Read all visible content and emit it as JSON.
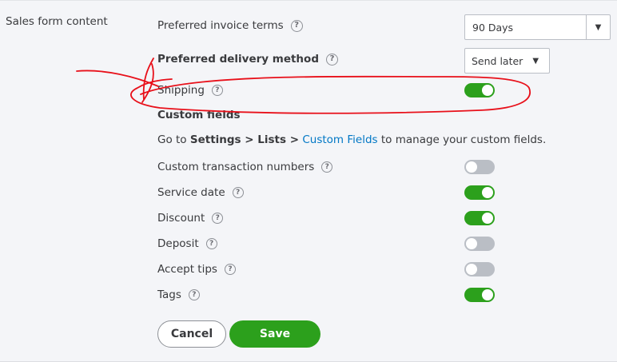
{
  "section": {
    "label": "Sales form content"
  },
  "invoice_terms": {
    "label": "Preferred invoice terms",
    "value": "90 Days"
  },
  "delivery_method": {
    "label": "Preferred delivery method",
    "value": "Send later"
  },
  "shipping": {
    "label": "Shipping",
    "enabled": true
  },
  "custom_fields": {
    "heading": "Custom fields",
    "info_prefix": "Go to ",
    "info_path": "Settings > Lists >",
    "info_link": "Custom Fields",
    "info_suffix": " to manage your custom fields."
  },
  "toggles": [
    {
      "label": "Custom transaction numbers",
      "enabled": false
    },
    {
      "label": "Service date",
      "enabled": true
    },
    {
      "label": "Discount",
      "enabled": true
    },
    {
      "label": "Deposit",
      "enabled": false
    },
    {
      "label": "Accept tips",
      "enabled": false
    },
    {
      "label": "Tags",
      "enabled": true
    }
  ],
  "buttons": {
    "cancel": "Cancel",
    "save": "Save"
  },
  "icons": {
    "help": "question-circle-icon",
    "dropdown": "caret-down-icon"
  },
  "colors": {
    "accent_green": "#2ca01c",
    "link_blue": "#0077c5",
    "annotation_red": "#e8101a",
    "toggle_off": "#babec5"
  }
}
